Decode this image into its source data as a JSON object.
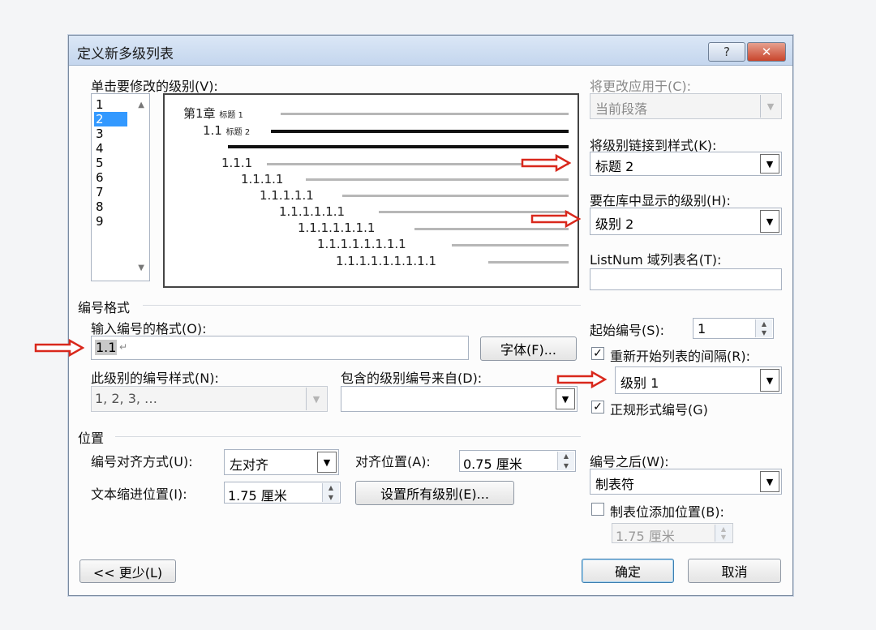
{
  "dialog": {
    "title": "定义新多级列表",
    "help_label": "?",
    "close_label": "✕"
  },
  "level_pane": {
    "label": "单击要修改的级别(V):",
    "items": [
      "1",
      "2",
      "3",
      "4",
      "5",
      "6",
      "7",
      "8",
      "9"
    ],
    "selected": "2"
  },
  "preview": {
    "rows": [
      {
        "text": "第1章",
        "suffix": "标题 1"
      },
      {
        "text": "1.1",
        "suffix": "标题 2"
      },
      {
        "text": "1.1.1"
      },
      {
        "text": "1.1.1.1"
      },
      {
        "text": "1.1.1.1.1"
      },
      {
        "text": "1.1.1.1.1.1"
      },
      {
        "text": "1.1.1.1.1.1.1"
      },
      {
        "text": "1.1.1.1.1.1.1.1"
      },
      {
        "text": "1.1.1.1.1.1.1.1.1"
      }
    ]
  },
  "right_panel": {
    "apply_to_label": "将更改应用于(C):",
    "apply_to_value": "当前段落",
    "link_style_label": "将级别链接到样式(K):",
    "link_style_value": "标题 2",
    "gallery_level_label": "要在库中显示的级别(H):",
    "gallery_level_value": "级别 2",
    "listnum_label": "ListNum 域列表名(T):",
    "listnum_value": ""
  },
  "number_format": {
    "section_label": "编号格式",
    "format_label": "输入编号的格式(O):",
    "format_value": "1.1",
    "font_button": "字体(F)...",
    "style_label": "此级别的编号样式(N):",
    "style_value": "1, 2, 3, …",
    "include_label": "包含的级别编号来自(D):",
    "include_value": "",
    "start_label": "起始编号(S):",
    "start_value": "1",
    "restart_label": "重新开始列表的间隔(R):",
    "restart_checked": true,
    "restart_value": "级别 1",
    "legal_label": "正规形式编号(G)",
    "legal_checked": true
  },
  "position": {
    "section_label": "位置",
    "align_label": "编号对齐方式(U):",
    "align_value": "左对齐",
    "align_at_label": "对齐位置(A):",
    "align_at_value": "0.75 厘米",
    "indent_label": "文本缩进位置(I):",
    "indent_value": "1.75 厘米",
    "set_all_button": "设置所有级别(E)...",
    "follow_label": "编号之后(W):",
    "follow_value": "制表符",
    "tab_stop_label": "制表位添加位置(B):",
    "tab_stop_checked": false,
    "tab_stop_value": "1.75 厘米"
  },
  "footer": {
    "less_button": "<< 更少(L)",
    "ok_button": "确定",
    "cancel_button": "取消"
  },
  "colors": {
    "selection": "#3399ff",
    "arrow": "#d9281c"
  }
}
